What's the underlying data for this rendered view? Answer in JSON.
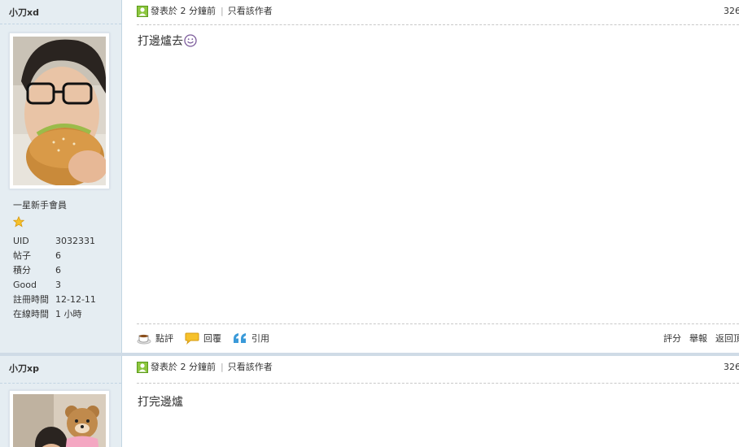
{
  "posts": [
    {
      "author": "小刀xd",
      "rank": "一星新手會員",
      "stats": [
        {
          "label": "UID",
          "value": "3032331"
        },
        {
          "label": "帖子",
          "value": "6"
        },
        {
          "label": "積分",
          "value": "6"
        },
        {
          "label": "Good",
          "value": "3"
        },
        {
          "label": "註冊時間",
          "value": "12-12-11"
        },
        {
          "label": "在線時間",
          "value": "1 小時"
        }
      ],
      "posted": "發表於 2 分鐘前",
      "only_author": "只看該作者",
      "floor": "326",
      "content": "打邊爐去",
      "actions": {
        "rate": "點評",
        "reply": "回覆",
        "quote": "引用"
      },
      "right_actions": {
        "score": "評分",
        "report": "舉報",
        "back": "返回頂"
      }
    },
    {
      "author": "小刀xp",
      "posted": "發表於 2 分鐘前",
      "only_author": "只看該作者",
      "floor": "326",
      "content": "打完邊爐"
    }
  ],
  "colors": {
    "sidebar_bg": "#e5edf2",
    "sidebar_border": "#c2d5e3",
    "separator": "#cfdbe6"
  }
}
